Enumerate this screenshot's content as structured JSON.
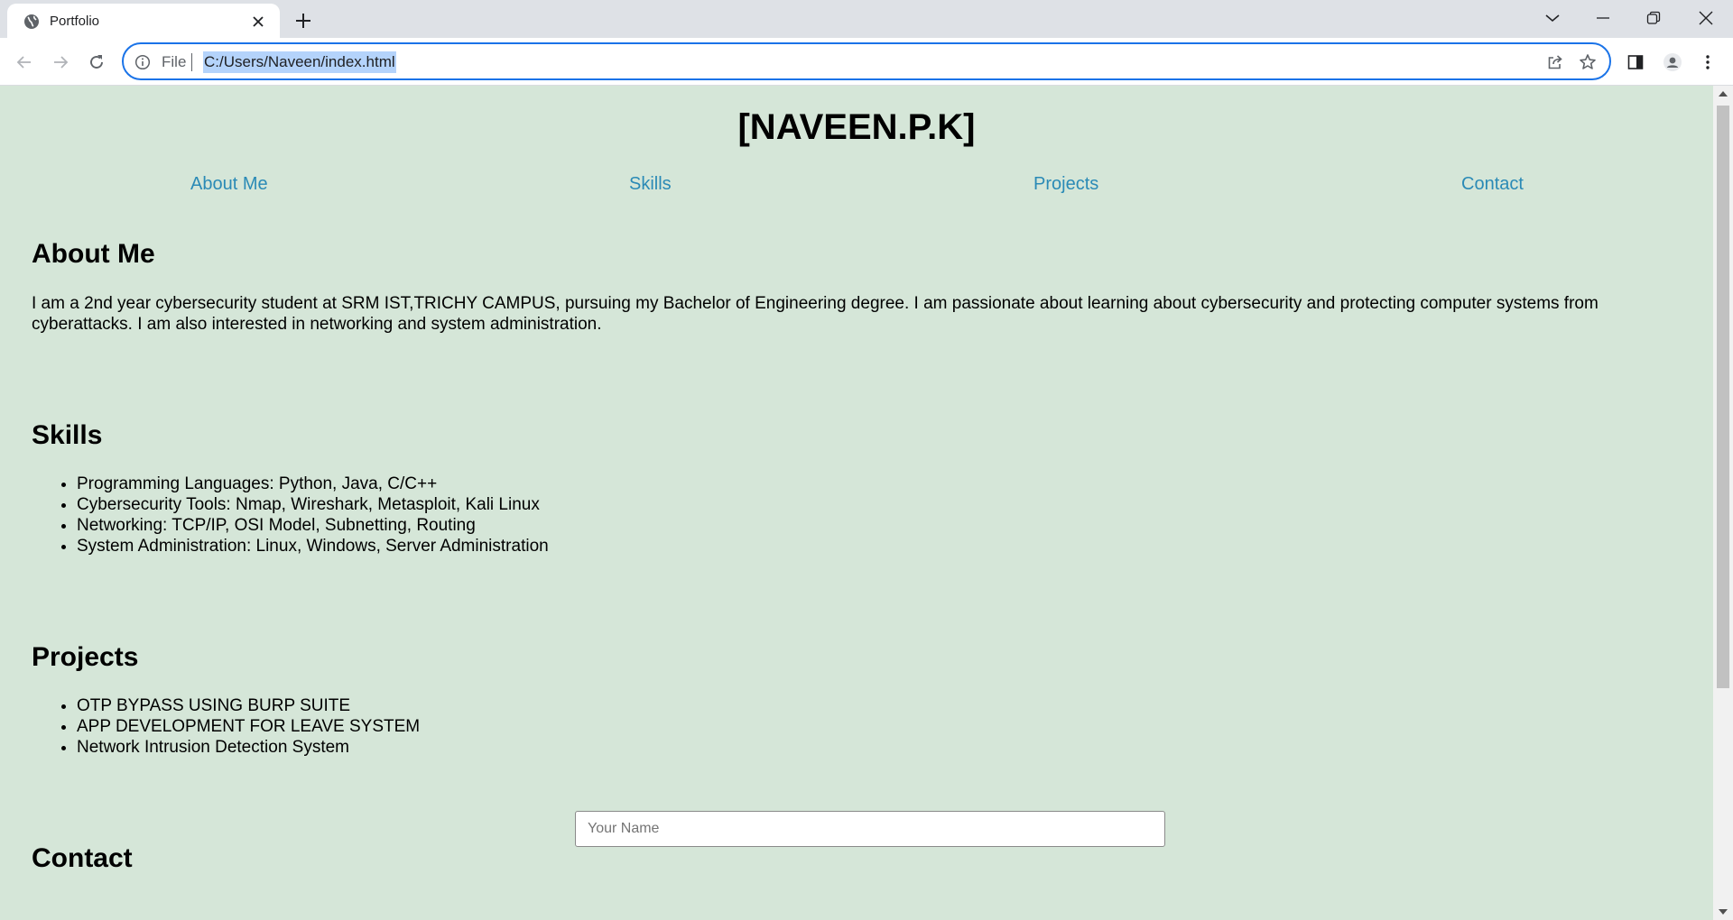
{
  "browser": {
    "tab_title": "Portfolio",
    "address_scheme": "File",
    "address_url": "C:/Users/Naveen/index.html"
  },
  "page": {
    "site_title": "[NAVEEN.P.K]",
    "nav": [
      "About Me",
      "Skills",
      "Projects",
      "Contact"
    ],
    "about": {
      "heading": "About Me",
      "text": "I am a 2nd year cybersecurity student at SRM IST,TRICHY CAMPUS, pursuing my Bachelor of Engineering degree. I am passionate about learning about cybersecurity and protecting computer systems from cyberattacks. I am also interested in networking and system administration."
    },
    "skills": {
      "heading": "Skills",
      "items": [
        "Programming Languages: Python, Java, C/C++",
        "Cybersecurity Tools: Nmap, Wireshark, Metasploit, Kali Linux",
        "Networking: TCP/IP, OSI Model, Subnetting, Routing",
        "System Administration: Linux, Windows, Server Administration"
      ]
    },
    "projects": {
      "heading": "Projects",
      "items": [
        "OTP BYPASS USING BURP SUITE",
        "APP DEVELOPMENT FOR LEAVE SYSTEM",
        "Network Intrusion Detection System"
      ]
    },
    "contact": {
      "heading": "Contact",
      "name_placeholder": "Your Name"
    }
  },
  "colors": {
    "page_background": "#d5e6d8",
    "nav_link": "#2a8ab6",
    "omnibox_focus": "#1a73e8",
    "url_selection": "#b4d3fb"
  },
  "icons": [
    "globe-icon",
    "close-icon",
    "plus-icon",
    "chevron-down-icon",
    "minimize-icon",
    "restore-icon",
    "window-close-icon",
    "back-arrow-icon",
    "forward-arrow-icon",
    "reload-icon",
    "info-icon",
    "share-icon",
    "star-icon",
    "side-panel-icon",
    "profile-icon",
    "kebab-menu-icon"
  ]
}
